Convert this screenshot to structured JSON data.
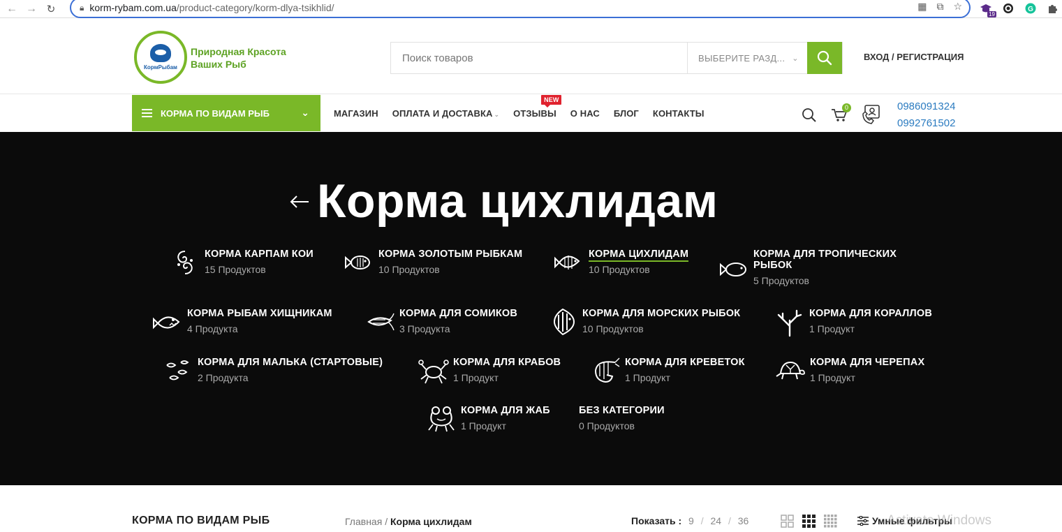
{
  "browser": {
    "url_host": "korm-rybam.com.ua",
    "url_path": "/product-category/korm-dlya-tsikhlid/",
    "extension_badge": "19"
  },
  "header": {
    "logo_text": "КормРыбам",
    "slogan_line1": "Природная Красота",
    "slogan_line2": "Ваших Рыб",
    "search_placeholder": "Поиск товаров",
    "search_category": "ВЫБЕРИТЕ РАЗД...",
    "login": "ВХОД / РЕГИСТРАЦИЯ"
  },
  "nav": {
    "categories_button": "КОРМА ПО ВИДАМ РЫБ",
    "menu": [
      {
        "label": "МАГАЗИН"
      },
      {
        "label": "ОПЛАТА И ДОСТАВКА"
      },
      {
        "label": "ОТЗЫВЫ",
        "badge": "NEW"
      },
      {
        "label": "О НАС"
      },
      {
        "label": "БЛОГ"
      },
      {
        "label": "КОНТАКТЫ"
      }
    ],
    "cart_count": "0",
    "phone1": "0986091324",
    "phone2": "0992761502"
  },
  "hero": {
    "title": "Корма цихлидам",
    "categories": [
      {
        "name": "КОРМА КАРПАМ КОИ",
        "count": "15 Продуктов",
        "icon": "koi-fish-icon"
      },
      {
        "name": "КОРМА ЗОЛОТЫМ РЫБКАМ",
        "count": "10 Продуктов",
        "icon": "goldfish-icon"
      },
      {
        "name": "КОРМА ЦИХЛИДАМ",
        "count": "10 Продуктов",
        "icon": "cichlid-icon"
      },
      {
        "name_line1": "КОРМА ДЛЯ ТРОПИЧЕСКИХ",
        "name_line2": "РЫБОК",
        "count": "5 Продуктов",
        "icon": "tropical-fish-icon"
      },
      {
        "name": "КОРМА РЫБАМ ХИЩНИКАМ",
        "count": "4 Продукта",
        "icon": "predator-fish-icon"
      },
      {
        "name": "КОРМА ДЛЯ СОМИКОВ",
        "count": "3 Продукта",
        "icon": "catfish-icon"
      },
      {
        "name": "КОРМА ДЛЯ МОРСКИХ РЫБОК",
        "count": "10 Продуктов",
        "icon": "marine-fish-icon"
      },
      {
        "name": "КОРМА ДЛЯ КОРАЛЛОВ",
        "count": "1 Продукт",
        "icon": "coral-icon"
      },
      {
        "name": "КОРМА ДЛЯ МАЛЬКА (СТАРТОВЫЕ)",
        "count": "2 Продукта",
        "icon": "fry-icon"
      },
      {
        "name": "КОРМА ДЛЯ КРАБОВ",
        "count": "1 Продукт",
        "icon": "crab-icon"
      },
      {
        "name": "КОРМА ДЛЯ КРЕВЕТОК",
        "count": "1 Продукт",
        "icon": "shrimp-icon"
      },
      {
        "name": "КОРМА ДЛЯ ЧЕРЕПАХ",
        "count": "1 Продукт",
        "icon": "turtle-icon"
      },
      {
        "name": "КОРМА ДЛЯ ЖАБ",
        "count": "1 Продукт",
        "icon": "frog-icon"
      },
      {
        "name": "БЕЗ КАТЕГОРИИ",
        "count": "0 Продуктов"
      }
    ]
  },
  "toolbar": {
    "sidebar_title": "КОРМА ПО ВИДАМ РЫБ",
    "breadcrumb_home": "Главная",
    "breadcrumb_sep": "/",
    "breadcrumb_current": "Корма цихлидам",
    "show_label": "Показать :",
    "show_options": [
      "9",
      "24",
      "36"
    ],
    "filters": "Умные фильтры",
    "watermark": "Activate Windows"
  },
  "colors": {
    "accent": "#7ab828",
    "hero_bg": "#0b0b0b",
    "phone": "#2b7bc0",
    "badge": "#e0222e"
  }
}
